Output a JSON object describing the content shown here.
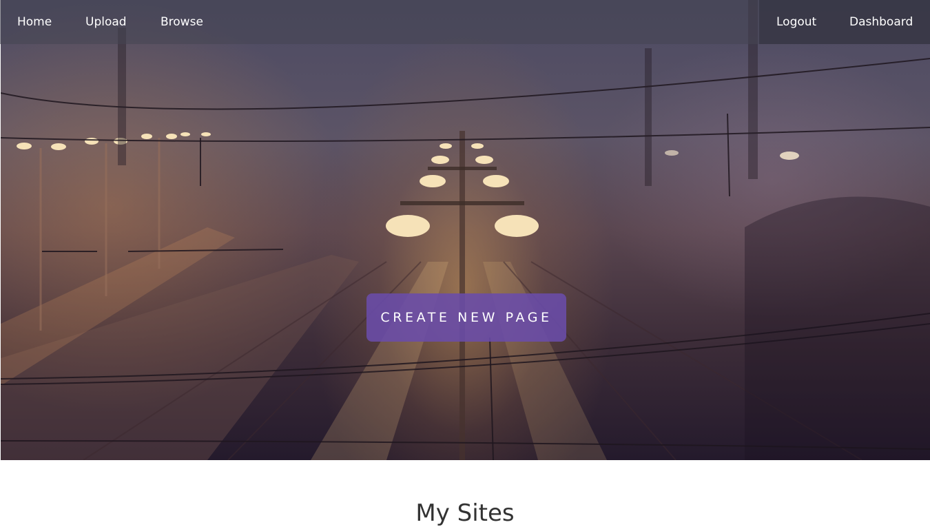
{
  "nav": {
    "left": [
      {
        "label": "Home"
      },
      {
        "label": "Upload"
      },
      {
        "label": "Browse"
      }
    ],
    "right": [
      {
        "label": "Logout"
      },
      {
        "label": "Dashboard"
      }
    ]
  },
  "hero": {
    "button_label": "CREATE NEW PAGE",
    "image": "foggy-railway-station-night-photo"
  },
  "sites": {
    "title": "My Sites"
  },
  "colors": {
    "button_bg": "#6a4caa",
    "nav_text": "#ffffff",
    "title_text": "#333333"
  }
}
